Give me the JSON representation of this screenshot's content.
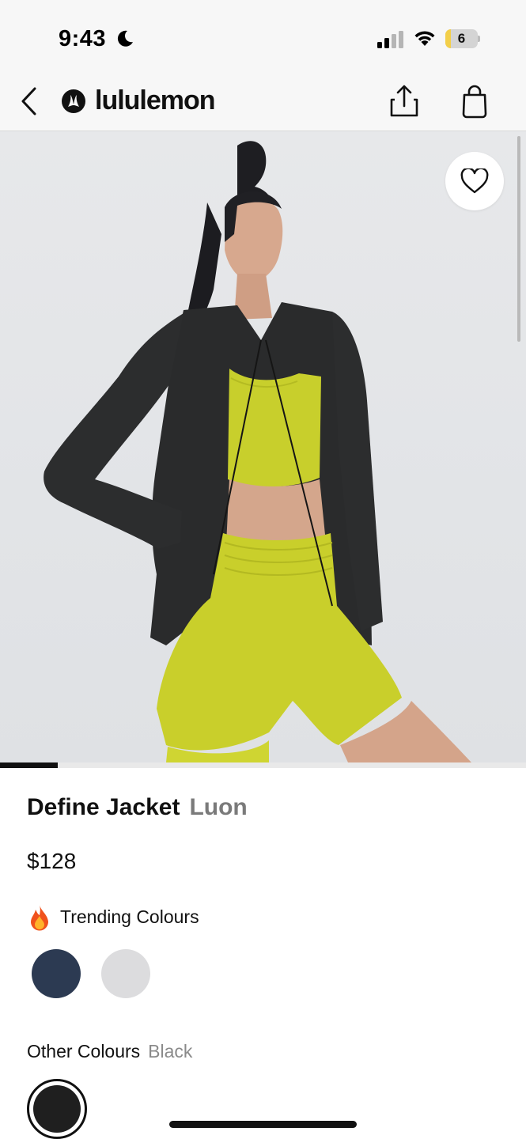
{
  "status_bar": {
    "time": "9:43",
    "battery_level": "6",
    "battery_fraction": 0.18,
    "icons": [
      "moon-icon",
      "signal-icon",
      "wifi-icon",
      "battery-icon"
    ]
  },
  "nav": {
    "brand": "lululemon",
    "icons": [
      "back-arrow-icon",
      "lululemon-logo-icon",
      "share-icon",
      "shopping-bag-icon"
    ]
  },
  "hero": {
    "favorite_icon": "heart-icon",
    "carousel_progress_fraction": 0.11
  },
  "product": {
    "name": "Define Jacket",
    "subname": "Luon",
    "price": "$128"
  },
  "trending": {
    "icon": "flame-icon",
    "label": "Trending Colours",
    "swatches": [
      {
        "name": "navy",
        "color": "#2c3a52"
      },
      {
        "name": "light-grey",
        "color": "#dcdcde"
      }
    ]
  },
  "other_colours": {
    "label": "Other Colours",
    "selected": "Black",
    "swatches": [
      {
        "name": "black",
        "color": "#1f1f1f"
      }
    ]
  },
  "colors": {
    "accent_yellow": "#c7cf2c",
    "jacket_black": "#2a2b2c",
    "background": "#ffffff"
  }
}
